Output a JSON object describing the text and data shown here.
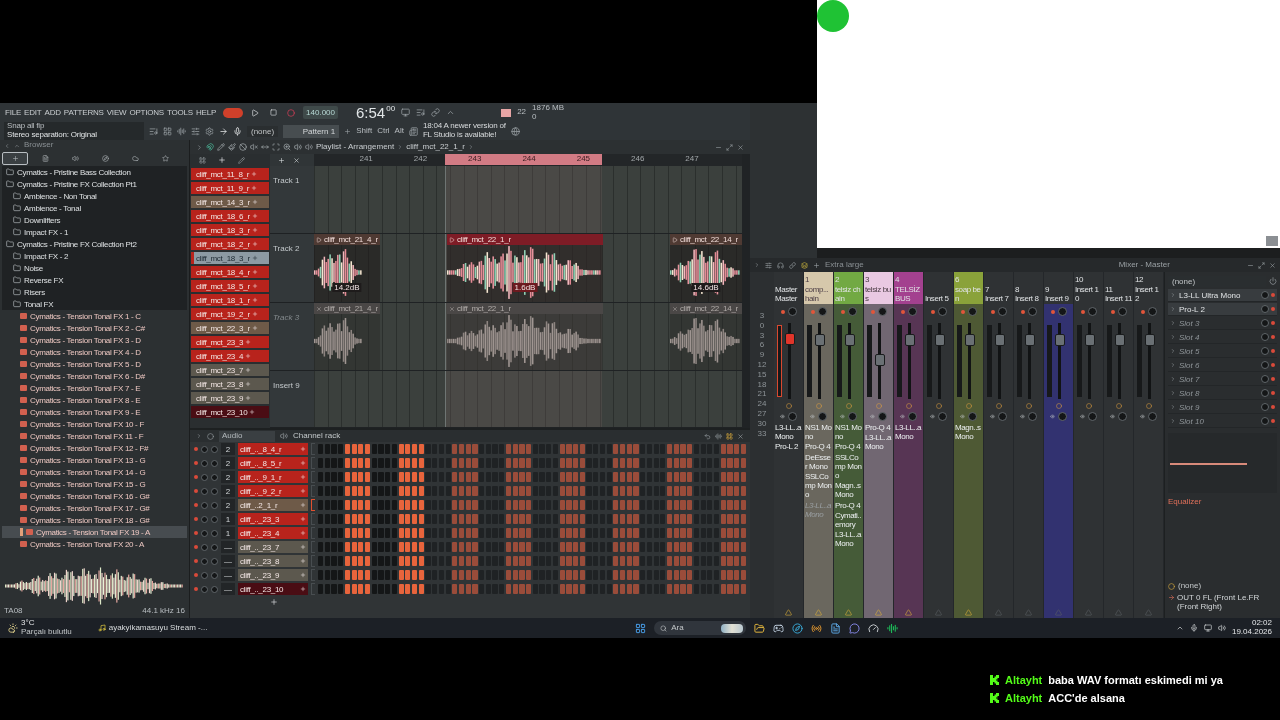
{
  "menu": [
    "FILE",
    "EDIT",
    "ADD",
    "PATTERNS",
    "VIEW",
    "OPTIONS",
    "TOOLS",
    "HELP"
  ],
  "transport": {
    "song_mode": true,
    "tempo": "140.000",
    "time": "6:54",
    "time_fraction": "00",
    "cpu": "22",
    "memory": "1876 MB",
    "polyphony": "0"
  },
  "hint": {
    "line_1": "Snap all fip",
    "line_2": "Stereo separation: Original"
  },
  "toolbar": {
    "output": "(none)",
    "pattern": "Pattern 1",
    "modifiers": [
      "Shift",
      "Ctrl",
      "Alt"
    ],
    "news": [
      "18:04  A newer version of",
      "FL Studio is available!"
    ]
  },
  "browser": {
    "title": "Browser",
    "tabs": [
      {
        "selected": true
      },
      {
        "selected": false
      },
      {
        "selected": false
      },
      {
        "selected": false
      },
      {
        "selected": false
      },
      {
        "selected": false
      }
    ],
    "tree": [
      {
        "kind": "folder",
        "name": "Cymatics - Pristine Bass Collection"
      },
      {
        "kind": "folder",
        "name": "Cymatics - Pristine FX Collection Pt1",
        "children": [
          {
            "kind": "folder",
            "name": "Ambience - Non Tonal"
          },
          {
            "kind": "folder",
            "name": "Ambience - Tonal"
          },
          {
            "kind": "folder",
            "name": "Downlifters"
          },
          {
            "kind": "folder",
            "name": "Impact FX - 1"
          }
        ]
      },
      {
        "kind": "folder",
        "name": "Cymatics - Pristine FX Collection Pt2",
        "children": [
          {
            "kind": "folder",
            "name": "Impact FX - 2"
          },
          {
            "kind": "folder",
            "name": "Noise"
          },
          {
            "kind": "folder",
            "name": "Reverse FX"
          },
          {
            "kind": "folder",
            "name": "Risers"
          },
          {
            "kind": "folder",
            "name": "Tonal FX",
            "children": [
              {
                "kind": "file",
                "name": "Cymatics - Tension Tonal FX 1 - C",
                "selected": false
              },
              {
                "kind": "file",
                "name": "Cymatics - Tension Tonal FX 2 - C#",
                "selected": false
              },
              {
                "kind": "file",
                "name": "Cymatics - Tension Tonal FX 3 - D",
                "selected": false
              },
              {
                "kind": "file",
                "name": "Cymatics - Tension Tonal FX 4 - D",
                "selected": false
              },
              {
                "kind": "file",
                "name": "Cymatics - Tension Tonal FX 5 - D",
                "selected": false
              },
              {
                "kind": "file",
                "name": "Cymatics - Tension Tonal FX 6 - D#",
                "selected": false
              },
              {
                "kind": "file",
                "name": "Cymatics - Tension Tonal FX 7 - E",
                "selected": false
              },
              {
                "kind": "file",
                "name": "Cymatics - Tension Tonal FX 8 - E",
                "selected": false
              },
              {
                "kind": "file",
                "name": "Cymatics - Tension Tonal FX 9 - E",
                "selected": false
              },
              {
                "kind": "file",
                "name": "Cymatics - Tension Tonal FX 10 - F",
                "selected": false
              },
              {
                "kind": "file",
                "name": "Cymatics - Tension Tonal FX 11 - F",
                "selected": false
              },
              {
                "kind": "file",
                "name": "Cymatics - Tension Tonal FX 12 - F#",
                "selected": false
              },
              {
                "kind": "file",
                "name": "Cymatics - Tension Tonal FX 13 - G",
                "selected": false
              },
              {
                "kind": "file",
                "name": "Cymatics - Tension Tonal FX 14 - G",
                "selected": false
              },
              {
                "kind": "file",
                "name": "Cymatics - Tension Tonal FX 15 - G",
                "selected": false
              },
              {
                "kind": "file",
                "name": "Cymatics - Tension Tonal FX 16 - G#",
                "selected": false
              },
              {
                "kind": "file",
                "name": "Cymatics - Tension Tonal FX 17 - G#",
                "selected": false
              },
              {
                "kind": "file",
                "name": "Cymatics - Tension Tonal FX 18 - G#",
                "selected": false
              },
              {
                "kind": "file",
                "name": "Cymatics - Tension Tonal FX 19 - A",
                "selected": true
              },
              {
                "kind": "file",
                "name": "Cymatics - Tension Tonal FX 20 - A",
                "selected": false
              }
            ]
          }
        ]
      }
    ],
    "preview": {
      "name": "TA08",
      "format": "44.1 kHz 16"
    }
  },
  "playlist": {
    "title": "Playlist - Arrangement",
    "breadcrumb": "cliff_mct_22_1_r",
    "ruler": [
      "241",
      "242",
      "243",
      "244",
      "245",
      "246",
      "247"
    ],
    "patterns": [
      {
        "name": "cliff_mct_11_8_r",
        "color": "#b8231c",
        "selected": false
      },
      {
        "name": "cliff_mct_11_9_r",
        "color": "#b8231c",
        "selected": false
      },
      {
        "name": "cliff_mct_14_3_r",
        "color": "#6e5a48",
        "selected": false
      },
      {
        "name": "cliff_mct_18_6_r",
        "color": "#b8231c",
        "selected": false
      },
      {
        "name": "cliff_mct_18_3_r",
        "color": "#b8231c",
        "selected": false
      },
      {
        "name": "cliff_mct_18_2_r",
        "color": "#b8231c",
        "selected": false
      },
      {
        "name": "cliff_mct_18_3_r",
        "color": "#b8231c",
        "selected": true
      },
      {
        "name": "cliff_mct_18_4_r",
        "color": "#b8231c",
        "selected": false
      },
      {
        "name": "cliff_mct_18_5_r",
        "color": "#b8231c",
        "selected": false
      },
      {
        "name": "cliff_mct_18_1_r",
        "color": "#b8231c",
        "selected": false
      },
      {
        "name": "cliff_mct_19_2_r",
        "color": "#b8231c",
        "selected": false
      },
      {
        "name": "cliff_mct_22_3_r",
        "color": "#6e5a48",
        "selected": false
      },
      {
        "name": "cliff_mct_23_3",
        "color": "#b8231c",
        "selected": false
      },
      {
        "name": "cliff_mct_23_4",
        "color": "#b8231c",
        "selected": false
      },
      {
        "name": "cliff_mct_23_7",
        "color": "#5c584e",
        "selected": false
      },
      {
        "name": "cliff_mct_23_8",
        "color": "#5c584e",
        "selected": false
      },
      {
        "name": "cliff_mct_23_9",
        "color": "#5c584e",
        "selected": false
      },
      {
        "name": "cliff_mct_23_10",
        "color": "#4a0d14",
        "selected": false
      }
    ],
    "tracks": [
      {
        "name": "Track 1",
        "muted": false
      },
      {
        "name": "Track 2",
        "muted": false,
        "clips": [
          {
            "name": "cliff_mct_21_4_r",
            "gain": "14.2dB",
            "selected": false
          },
          {
            "name": "cliff_mct_22_1_r",
            "gain": "1.6dB",
            "selected": true
          },
          {
            "name": "cliff_mct_22_14_r",
            "gain": "14.6dB",
            "selected": false
          }
        ]
      },
      {
        "name": "Track 3",
        "muted": true,
        "clips": [
          {
            "name": "cliff_mct_21_4_r",
            "selected": false
          },
          {
            "name": "cliff_mct_22_1_r",
            "selected": false
          },
          {
            "name": "cliff_mct_22_14_r",
            "selected": false
          }
        ]
      },
      {
        "name": "Insert 9",
        "muted": false
      }
    ]
  },
  "channel_rack": {
    "title": "Channel rack",
    "group": "Audio",
    "channels": [
      {
        "number": "2",
        "name": "cliff_.._8_4_r",
        "color": "#b8231c",
        "selected": false,
        "steps": [
          false,
          false,
          false,
          false,
          true,
          true,
          true,
          true,
          false,
          false,
          false,
          false,
          true,
          true,
          true,
          true,
          false,
          false,
          false,
          false,
          true,
          true,
          true,
          true,
          false,
          false,
          false,
          false,
          true,
          true,
          true,
          true,
          false,
          false,
          false,
          false,
          true,
          true,
          true,
          true,
          false,
          false,
          false,
          false,
          true,
          true,
          true,
          true,
          false,
          false,
          false,
          false,
          true,
          true,
          true,
          true,
          false,
          false,
          false,
          false,
          true,
          true,
          true,
          true
        ]
      },
      {
        "number": "2",
        "name": "cliff_.._8_5_r",
        "color": "#b8231c",
        "selected": false,
        "steps": [
          false,
          false,
          false,
          false,
          true,
          true,
          true,
          true,
          false,
          false,
          false,
          false,
          true,
          true,
          true,
          true,
          false,
          false,
          false,
          false,
          true,
          true,
          true,
          true,
          false,
          false,
          false,
          false,
          true,
          true,
          true,
          true,
          false,
          false,
          false,
          false,
          true,
          true,
          true,
          true,
          false,
          false,
          false,
          false,
          true,
          true,
          true,
          true,
          false,
          false,
          false,
          false,
          true,
          true,
          true,
          true,
          false,
          false,
          false,
          false,
          true,
          true,
          true,
          true
        ]
      },
      {
        "number": "2",
        "name": "cliff_.._9_1_r",
        "color": "#b8231c",
        "selected": false,
        "steps": [
          false,
          false,
          false,
          false,
          true,
          true,
          true,
          true,
          false,
          false,
          false,
          false,
          true,
          true,
          true,
          true,
          false,
          false,
          false,
          false,
          true,
          true,
          true,
          true,
          false,
          false,
          false,
          false,
          true,
          true,
          true,
          true,
          false,
          false,
          false,
          false,
          true,
          true,
          true,
          true,
          false,
          false,
          false,
          false,
          true,
          true,
          true,
          true,
          false,
          false,
          false,
          false,
          true,
          true,
          true,
          true,
          false,
          false,
          false,
          false,
          true,
          true,
          true,
          true
        ]
      },
      {
        "number": "2",
        "name": "cliff_.._9_2_r",
        "color": "#b8231c",
        "selected": false,
        "steps": [
          false,
          false,
          false,
          false,
          true,
          true,
          true,
          true,
          false,
          false,
          false,
          false,
          true,
          true,
          true,
          true,
          false,
          false,
          false,
          false,
          true,
          true,
          true,
          true,
          false,
          false,
          false,
          false,
          true,
          true,
          true,
          true,
          false,
          false,
          false,
          false,
          true,
          true,
          true,
          true,
          false,
          false,
          false,
          false,
          true,
          true,
          true,
          true,
          false,
          false,
          false,
          false,
          true,
          true,
          true,
          true,
          false,
          false,
          false,
          false,
          true,
          true,
          true,
          true
        ]
      },
      {
        "number": "2",
        "name": "cliff_..2_1_r",
        "color": "#6e5a48",
        "selected": true,
        "steps": [
          false,
          false,
          false,
          false,
          true,
          true,
          true,
          true,
          false,
          false,
          false,
          false,
          true,
          true,
          true,
          true,
          false,
          false,
          false,
          false,
          true,
          true,
          true,
          true,
          false,
          false,
          false,
          false,
          true,
          true,
          true,
          true,
          false,
          false,
          false,
          false,
          true,
          true,
          true,
          true,
          false,
          false,
          false,
          false,
          true,
          true,
          true,
          true,
          false,
          false,
          false,
          false,
          true,
          true,
          true,
          true,
          false,
          false,
          false,
          false,
          true,
          true,
          true,
          true
        ]
      },
      {
        "number": "1",
        "name": "cliff_.._23_3",
        "color": "#b8231c",
        "selected": false,
        "steps": [
          false,
          false,
          false,
          false,
          true,
          true,
          true,
          true,
          false,
          false,
          false,
          false,
          true,
          true,
          true,
          true,
          false,
          false,
          false,
          false,
          true,
          true,
          true,
          true,
          false,
          false,
          false,
          false,
          true,
          true,
          true,
          true,
          false,
          false,
          false,
          false,
          true,
          true,
          true,
          true,
          false,
          false,
          false,
          false,
          true,
          true,
          true,
          true,
          false,
          false,
          false,
          false,
          true,
          true,
          true,
          true,
          false,
          false,
          false,
          false,
          true,
          true,
          true,
          true
        ]
      },
      {
        "number": "1",
        "name": "cliff_.._23_4",
        "color": "#b8231c",
        "selected": false,
        "steps": [
          false,
          false,
          false,
          false,
          true,
          true,
          true,
          true,
          false,
          false,
          false,
          false,
          true,
          true,
          true,
          true,
          false,
          false,
          false,
          false,
          true,
          true,
          true,
          true,
          false,
          false,
          false,
          false,
          true,
          true,
          true,
          true,
          false,
          false,
          false,
          false,
          true,
          true,
          true,
          true,
          false,
          false,
          false,
          false,
          true,
          true,
          true,
          true,
          false,
          false,
          false,
          false,
          true,
          true,
          true,
          true,
          false,
          false,
          false,
          false,
          true,
          true,
          true,
          true
        ]
      },
      {
        "number": "—",
        "name": "cliff_.._23_7",
        "color": "#5c584e",
        "selected": false,
        "steps": [
          false,
          false,
          false,
          false,
          true,
          true,
          true,
          true,
          false,
          false,
          false,
          false,
          true,
          true,
          true,
          true,
          false,
          false,
          false,
          false,
          true,
          true,
          true,
          true,
          false,
          false,
          false,
          false,
          true,
          true,
          true,
          true,
          false,
          false,
          false,
          false,
          true,
          true,
          true,
          true,
          false,
          false,
          false,
          false,
          true,
          true,
          true,
          true,
          false,
          false,
          false,
          false,
          true,
          true,
          true,
          true,
          false,
          false,
          false,
          false,
          true,
          true,
          true,
          true
        ]
      },
      {
        "number": "—",
        "name": "cliff_.._23_8",
        "color": "#5c584e",
        "selected": false,
        "steps": [
          false,
          false,
          false,
          false,
          true,
          true,
          true,
          true,
          false,
          false,
          false,
          false,
          true,
          true,
          true,
          true,
          false,
          false,
          false,
          false,
          true,
          true,
          true,
          true,
          false,
          false,
          false,
          false,
          true,
          true,
          true,
          true,
          false,
          false,
          false,
          false,
          true,
          true,
          true,
          true,
          false,
          false,
          false,
          false,
          true,
          true,
          true,
          true,
          false,
          false,
          false,
          false,
          true,
          true,
          true,
          true,
          false,
          false,
          false,
          false,
          true,
          true,
          true,
          true
        ]
      },
      {
        "number": "—",
        "name": "cliff_.._23_9",
        "color": "#5c584e",
        "selected": false,
        "steps": [
          false,
          false,
          false,
          false,
          true,
          true,
          true,
          true,
          false,
          false,
          false,
          false,
          true,
          true,
          true,
          true,
          false,
          false,
          false,
          false,
          true,
          true,
          true,
          true,
          false,
          false,
          false,
          false,
          true,
          true,
          true,
          true,
          false,
          false,
          false,
          false,
          true,
          true,
          true,
          true,
          false,
          false,
          false,
          false,
          true,
          true,
          true,
          true,
          false,
          false,
          false,
          false,
          true,
          true,
          true,
          true,
          false,
          false,
          false,
          false,
          true,
          true,
          true,
          true
        ]
      },
      {
        "number": "—",
        "name": "cliff_.._23_10",
        "color": "#4a0d14",
        "selected": false,
        "steps": [
          false,
          false,
          false,
          false,
          true,
          true,
          true,
          true,
          false,
          false,
          false,
          false,
          true,
          true,
          true,
          true,
          false,
          false,
          false,
          false,
          true,
          true,
          true,
          true,
          false,
          false,
          false,
          false,
          true,
          true,
          true,
          true,
          false,
          false,
          false,
          false,
          true,
          true,
          true,
          true,
          false,
          false,
          false,
          false,
          true,
          true,
          true,
          true,
          false,
          false,
          false,
          false,
          true,
          true,
          true,
          true,
          false,
          false,
          false,
          false,
          true,
          true,
          true,
          true
        ]
      }
    ]
  },
  "mixer": {
    "size_label": "Extra large",
    "title": "Mixer - Master",
    "scale": [
      "3",
      "0",
      "3",
      "6",
      "9",
      "12",
      "15",
      "18",
      "21",
      "24",
      "27",
      "30",
      "33"
    ],
    "strips": [
      {
        "kind": "master",
        "label": "Master",
        "name": "Master",
        "selected": false,
        "level": 0.8,
        "routed": true,
        "effects": [
          {
            "name": "L3-LL..a Mono",
            "enabled": true
          },
          {
            "name": "Pro-L 2",
            "enabled": true
          }
        ]
      },
      {
        "kind": "insert",
        "label": "1",
        "name": "comp...hain",
        "color": "#d6c8ab",
        "selected": false,
        "level": 0.78,
        "routed": true,
        "effects": [
          {
            "name": "NS1 Mono",
            "enabled": true
          },
          {
            "name": "Pro-Q 4",
            "enabled": true
          },
          {
            "name": "DeEsser Mono",
            "enabled": true
          },
          {
            "name": "SSLComp Mono",
            "enabled": true
          },
          {
            "name": "L3-LL..a Mono",
            "enabled": false
          }
        ]
      },
      {
        "kind": "insert",
        "label": "2",
        "name": "telsiz chain",
        "color": "#72a943",
        "selected": false,
        "level": 0.78,
        "routed": true,
        "effects": [
          {
            "name": "NS1 Mono",
            "enabled": true
          },
          {
            "name": "Pro-Q 4",
            "enabled": true
          },
          {
            "name": "SSLComp Mono",
            "enabled": true
          },
          {
            "name": "Magn..s Mono",
            "enabled": true
          },
          {
            "name": "Pro-Q 4",
            "enabled": true
          },
          {
            "name": "Cymati..emory",
            "enabled": true
          },
          {
            "name": "L3-LL..a Mono",
            "enabled": true
          }
        ]
      },
      {
        "kind": "insert",
        "label": "3",
        "name": "telsiz bus",
        "color": "#e9c9e2",
        "selected": false,
        "level": 0.5,
        "routed": true,
        "effects": [
          {
            "name": "Pro-Q 4",
            "enabled": true
          },
          {
            "name": "L3-LL..a Mono",
            "enabled": true
          }
        ]
      },
      {
        "kind": "insert",
        "label": "4",
        "name": "TELSİZ BUS",
        "color": "#a3418f",
        "selected": false,
        "level": 0.78,
        "routed": true,
        "effects": [
          {
            "name": "L3-LL..a Mono",
            "enabled": true
          }
        ]
      },
      {
        "kind": "insert",
        "name": "Insert 5",
        "selected": false,
        "level": 0.78,
        "routed": false
      },
      {
        "kind": "insert",
        "label": "6",
        "name": "soap ben",
        "color": "#8aa23a",
        "selected": false,
        "level": 0.78,
        "routed": true,
        "effects": [
          {
            "name": "Magn..s Mono",
            "enabled": true
          }
        ]
      },
      {
        "kind": "insert",
        "label": "7",
        "name": "Insert 7",
        "selected": false,
        "level": 0.78,
        "routed": false
      },
      {
        "kind": "insert",
        "label": "8",
        "name": "Insert 8",
        "selected": false,
        "level": 0.78,
        "routed": false
      },
      {
        "kind": "insert",
        "label": "9",
        "name": "Insert 9",
        "selected": true,
        "level": 0.78,
        "routed": false
      },
      {
        "kind": "insert",
        "label": "10",
        "name": "Insert 10",
        "selected": false,
        "level": 0.78,
        "routed": false
      },
      {
        "kind": "insert",
        "label": "11",
        "name": "Insert 11",
        "selected": false,
        "level": 0.78,
        "routed": false
      },
      {
        "kind": "insert",
        "label": "12",
        "name": "Insert 12",
        "selected": false,
        "level": 0.78,
        "routed": false
      }
    ],
    "preset": "(none)",
    "slots": [
      {
        "name": "L3-LL Ultra Mono",
        "empty": false
      },
      {
        "name": "Pro-L 2",
        "empty": false
      },
      {
        "name": "Slot 3",
        "empty": true
      },
      {
        "name": "Slot 4",
        "empty": true
      },
      {
        "name": "Slot 5",
        "empty": true
      },
      {
        "name": "Slot 6",
        "empty": true
      },
      {
        "name": "Slot 7",
        "empty": true
      },
      {
        "name": "Slot 8",
        "empty": true
      },
      {
        "name": "Slot 9",
        "empty": true
      },
      {
        "name": "Slot 10",
        "empty": true
      }
    ],
    "eq_label": "Equalizer",
    "input": "(none)",
    "output": "OUT 0 FL (Front Le.FR (Front Right)"
  },
  "taskbar": {
    "temperature": "3°C",
    "weather": "Parçalı bulutlu",
    "app": "ayakyikamasuyu Stream -...",
    "search": "Ara",
    "time": "02:02",
    "date": "19.04.2026"
  },
  "chat": [
    {
      "user": "Altayht",
      "message": "baba WAV formatı eskimedi mi ya"
    },
    {
      "user": "Altayht",
      "message": "ACC'de alsana"
    }
  ]
}
